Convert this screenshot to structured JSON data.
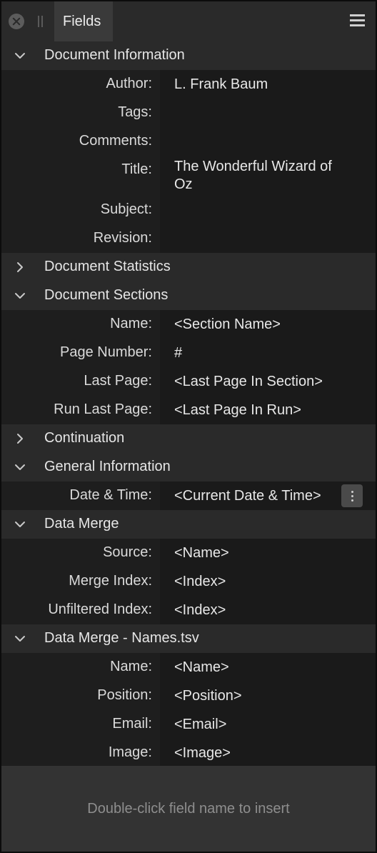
{
  "titlebar": {
    "tab_label": "Fields"
  },
  "sections": [
    {
      "title": "Document Information",
      "expanded": true,
      "fields": [
        {
          "label": "Author:",
          "value": "L. Frank Baum"
        },
        {
          "label": "Tags:",
          "value": ""
        },
        {
          "label": "Comments:",
          "value": ""
        },
        {
          "label": "Title:",
          "value": "The Wonderful Wizard of Oz"
        },
        {
          "label": "Subject:",
          "value": ""
        },
        {
          "label": "Revision:",
          "value": ""
        }
      ]
    },
    {
      "title": "Document Statistics",
      "expanded": false,
      "fields": []
    },
    {
      "title": "Document Sections",
      "expanded": true,
      "fields": [
        {
          "label": "Name:",
          "value": "<Section Name>"
        },
        {
          "label": "Page Number:",
          "value": "#"
        },
        {
          "label": "Last Page:",
          "value": "<Last Page In Section>"
        },
        {
          "label": "Run Last Page:",
          "value": "<Last Page In Run>"
        }
      ]
    },
    {
      "title": "Continuation",
      "expanded": false,
      "fields": []
    },
    {
      "title": "General Information",
      "expanded": true,
      "fields": [
        {
          "label": "Date & Time:",
          "value": "<Current Date & Time>"
        }
      ]
    },
    {
      "title": "Data Merge",
      "expanded": true,
      "fields": [
        {
          "label": "Source:",
          "value": "<Name>"
        },
        {
          "label": "Merge Index:",
          "value": "<Index>"
        },
        {
          "label": "Unfiltered Index:",
          "value": "<Index>"
        }
      ]
    },
    {
      "title": "Data Merge - Names.tsv",
      "expanded": true,
      "fields": [
        {
          "label": "Name:",
          "value": "<Name>"
        },
        {
          "label": "Position:",
          "value": "<Position>"
        },
        {
          "label": "Email:",
          "value": "<Email>"
        },
        {
          "label": "Image:",
          "value": "<Image>"
        }
      ]
    }
  ],
  "footer": {
    "hint": "Double-click field name to insert"
  },
  "icons": {
    "close": "close-icon",
    "drag": "drag-handle-icon",
    "menu": "hamburger-menu-icon",
    "expanded": "chevron-down-icon",
    "collapsed": "chevron-right-icon",
    "options": "vertical-ellipsis-icon"
  }
}
